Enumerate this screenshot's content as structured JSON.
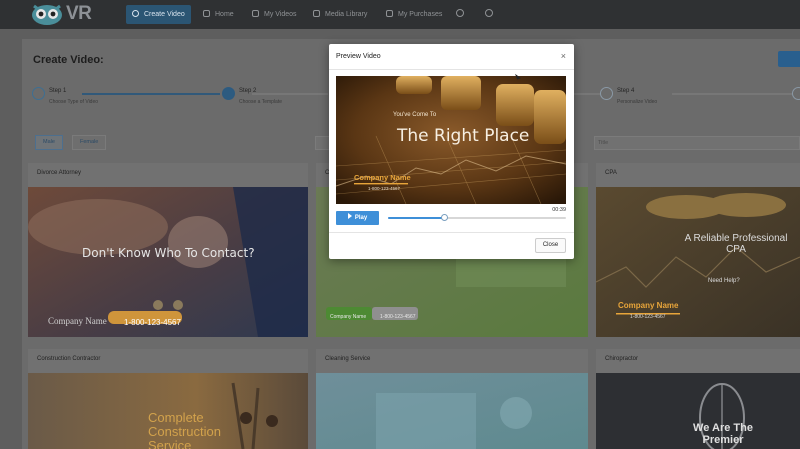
{
  "app": {
    "logo_text": "VR",
    "nav": [
      {
        "label": "Create Video",
        "active": true
      },
      {
        "label": "Home"
      },
      {
        "label": "My Videos"
      },
      {
        "label": "Media Library"
      },
      {
        "label": "My Purchases"
      }
    ]
  },
  "page": {
    "title": "Create Video:",
    "steps": [
      {
        "title": "Step 1",
        "subtitle": "Choose Type of Video",
        "state": "done"
      },
      {
        "title": "Step 2",
        "subtitle": "Choose a Template",
        "state": "current"
      },
      {
        "title": "Step 4",
        "subtitle": "Personalize Video",
        "state": "todo"
      }
    ],
    "filters": {
      "male": "Male",
      "female": "Female"
    },
    "search_placeholder": "Title"
  },
  "cards": [
    {
      "caption": "Divorce Attorney",
      "overlay_title": "Don't Know Who To Contact?",
      "overlay_company": "Company Name",
      "overlay_phone": "1-800-123-4567"
    },
    {
      "caption": "C",
      "overlay_company": "Company Name",
      "overlay_phone": "1-800-123-4567"
    },
    {
      "caption": "CPA",
      "overlay_title": "A Reliable Professional CPA",
      "overlay_sub": "Need Help?",
      "overlay_company": "Company Name",
      "overlay_phone": "1-800-123-4567"
    },
    {
      "caption": "Construction Contractor",
      "overlay_title": "Complete Construction Service"
    },
    {
      "caption": "Cleaning Service"
    },
    {
      "caption": "Chiropractor",
      "overlay_title": "We Are The Premier"
    }
  ],
  "modal": {
    "title": "Preview Video",
    "close_x": "×",
    "video": {
      "intro": "You've Come To",
      "headline": "The Right Place",
      "company": "Company Name",
      "phone": "1-800-123-4567"
    },
    "play_label": "Play",
    "time": "00:39",
    "progress": 0.32,
    "close_label": "Close"
  },
  "colors": {
    "accent": "#3e8fd8",
    "nav_bg": "#2f3133",
    "overlay_gold": "#e8a53a"
  }
}
